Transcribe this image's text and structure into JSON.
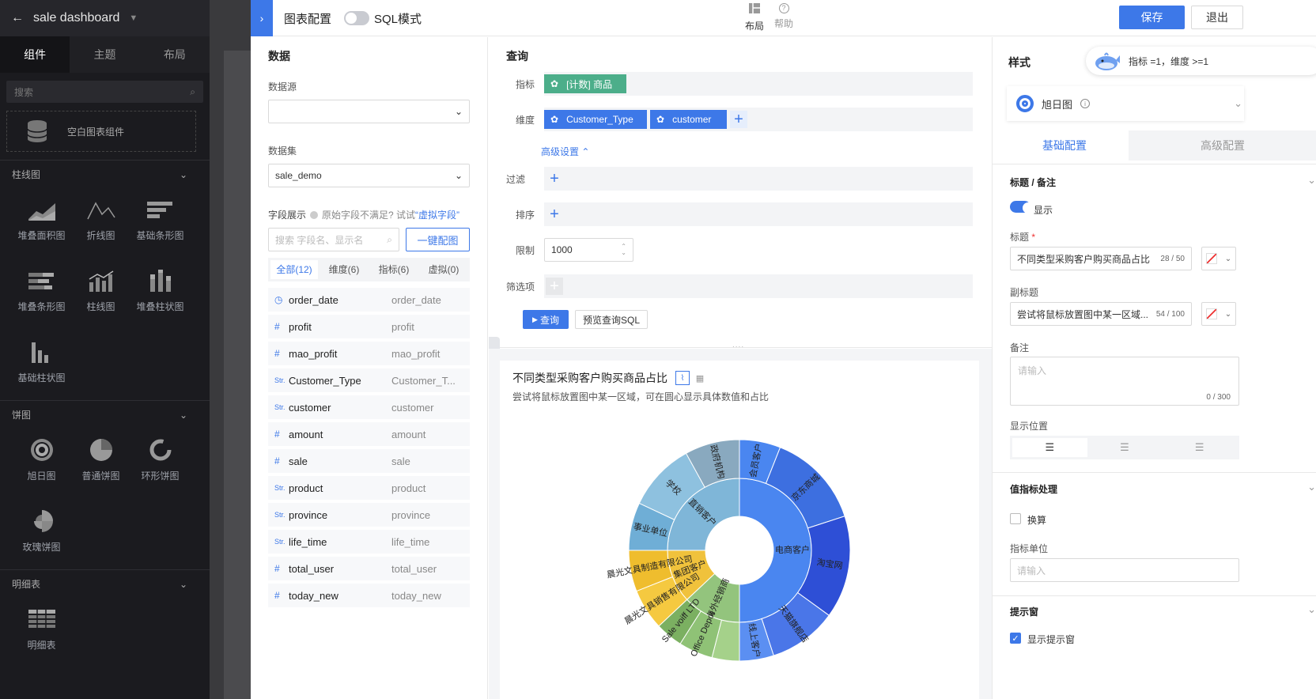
{
  "app": {
    "title": "sale dashboard"
  },
  "left_tabs": [
    "组件",
    "主题",
    "布局"
  ],
  "left_search_placeholder": "搜索",
  "empty_component": "空白图表组件",
  "sections": {
    "bar": {
      "title": "柱线图",
      "items": [
        "堆叠面积图",
        "折线图",
        "基础条形图",
        "堆叠条形图",
        "柱线图",
        "堆叠柱状图",
        "基础柱状图"
      ]
    },
    "pie": {
      "title": "饼图",
      "items": [
        "旭日图",
        "普通饼图",
        "环形饼图",
        "玫瑰饼图"
      ]
    },
    "detail": {
      "title": "明细表",
      "items": [
        "明细表"
      ]
    }
  },
  "header": {
    "config_title": "图表配置",
    "sql_mode": "SQL模式",
    "layout": "布局",
    "help": "帮助",
    "save": "保存",
    "exit": "退出"
  },
  "data_panel": {
    "title": "数据",
    "source_label": "数据源",
    "source_value": "",
    "dataset_label": "数据集",
    "dataset_value": "sale_demo",
    "fields_label": "字段展示",
    "fields_hint": "原始字段不满足? 试试",
    "virtual_link": "“虚拟字段”",
    "search_placeholder": "搜索 字段名、显示名",
    "auto_btn": "一键配图",
    "tabs": [
      "全部(12)",
      "维度(6)",
      "指标(6)",
      "虚拟(0)"
    ],
    "fields": [
      {
        "type": "date",
        "icon": "◷",
        "name": "order_date",
        "alias": "order_date"
      },
      {
        "type": "num",
        "icon": "#",
        "name": "profit",
        "alias": "profit"
      },
      {
        "type": "num",
        "icon": "#",
        "name": "mao_profit",
        "alias": "mao_profit"
      },
      {
        "type": "str",
        "icon": "Str.",
        "name": "Customer_Type",
        "alias": "Customer_T..."
      },
      {
        "type": "str",
        "icon": "Str.",
        "name": "customer",
        "alias": "customer"
      },
      {
        "type": "num",
        "icon": "#",
        "name": "amount",
        "alias": "amount"
      },
      {
        "type": "num",
        "icon": "#",
        "name": "sale",
        "alias": "sale"
      },
      {
        "type": "str",
        "icon": "Str.",
        "name": "product",
        "alias": "product"
      },
      {
        "type": "str",
        "icon": "Str.",
        "name": "province",
        "alias": "province"
      },
      {
        "type": "str",
        "icon": "Str.",
        "name": "life_time",
        "alias": "life_time"
      },
      {
        "type": "num",
        "icon": "#",
        "name": "total_user",
        "alias": "total_user"
      },
      {
        "type": "num",
        "icon": "#",
        "name": "today_new",
        "alias": "today_new"
      }
    ]
  },
  "query": {
    "title": "查询",
    "metric_label": "指标",
    "metric_pill": "[计数] 商品",
    "dim_label": "维度",
    "dim_pills": [
      "Customer_Type",
      "customer"
    ],
    "advanced": "高级设置",
    "filter_label": "过滤",
    "sort_label": "排序",
    "limit_label": "限制",
    "limit_value": "1000",
    "options_label": "筛选项",
    "query_btn": "查询",
    "preview_btn": "预览查询SQL"
  },
  "chart": {
    "title": "不同类型采购客户购买商品占比",
    "subtitle": "尝试将鼠标放置图中某一区域，可在圆心显示具体数值和占比"
  },
  "chart_data": {
    "type": "sunburst",
    "inner": [
      {
        "name": "电商客户",
        "value": 50,
        "color": "#4a86f0"
      },
      {
        "name": "海外经销商",
        "value": 13,
        "color": "#93c47d"
      },
      {
        "name": "集团客户",
        "value": 12,
        "color": "#f0c23c"
      },
      {
        "name": "直销客户",
        "value": 25,
        "color": "#7fb6d8"
      }
    ],
    "outer": [
      {
        "name": "会员客户",
        "value": 6,
        "color": "#4a86f0"
      },
      {
        "name": "京东商城",
        "value": 14,
        "color": "#3d6fe0"
      },
      {
        "name": "淘宝网",
        "value": 15,
        "color": "#2e4fd6"
      },
      {
        "name": "天猫旗舰店",
        "value": 10,
        "color": "#4a76e8"
      },
      {
        "name": "线上客户",
        "value": 5,
        "color": "#5b8ff2"
      },
      {
        "name": "",
        "value": 4,
        "color": "#a5d18a"
      },
      {
        "name": "Office Depot",
        "value": 5,
        "color": "#8fc276"
      },
      {
        "name": "Sale voiff LTD",
        "value": 4,
        "color": "#7bb061"
      },
      {
        "name": "晨光文具销售有限公司",
        "value": 6,
        "color": "#f5c940"
      },
      {
        "name": "晨光文具制造有限公司",
        "value": 6,
        "color": "#efbd2e"
      },
      {
        "name": "事业单位",
        "value": 7,
        "color": "#6faed6"
      },
      {
        "name": "学校",
        "value": 10,
        "color": "#8ec1df"
      },
      {
        "name": "政府机构",
        "value": 8,
        "color": "#89a9bf"
      }
    ]
  },
  "style_panel": {
    "title": "样式",
    "bubble": "指标 =1，维度 >=1",
    "chart_type": "旭日图",
    "tabs": [
      "基础配置",
      "高级配置"
    ],
    "title_section": "标题 / 备注",
    "show": "显示",
    "title_label": "标题",
    "title_value": "不同类型采购客户购买商品占比",
    "title_count": "28 / 50",
    "subtitle_label": "副标题",
    "subtitle_value": "尝试将鼠标放置图中某一区域...",
    "subtitle_count": "54 / 100",
    "note_label": "备注",
    "note_placeholder": "请输入",
    "note_count": "0 / 300",
    "position_label": "显示位置",
    "value_section": "值指标处理",
    "convert": "换算",
    "unit_label": "指标单位",
    "unit_placeholder": "请输入",
    "tooltip_section": "提示窗",
    "tooltip_show": "显示提示窗"
  }
}
